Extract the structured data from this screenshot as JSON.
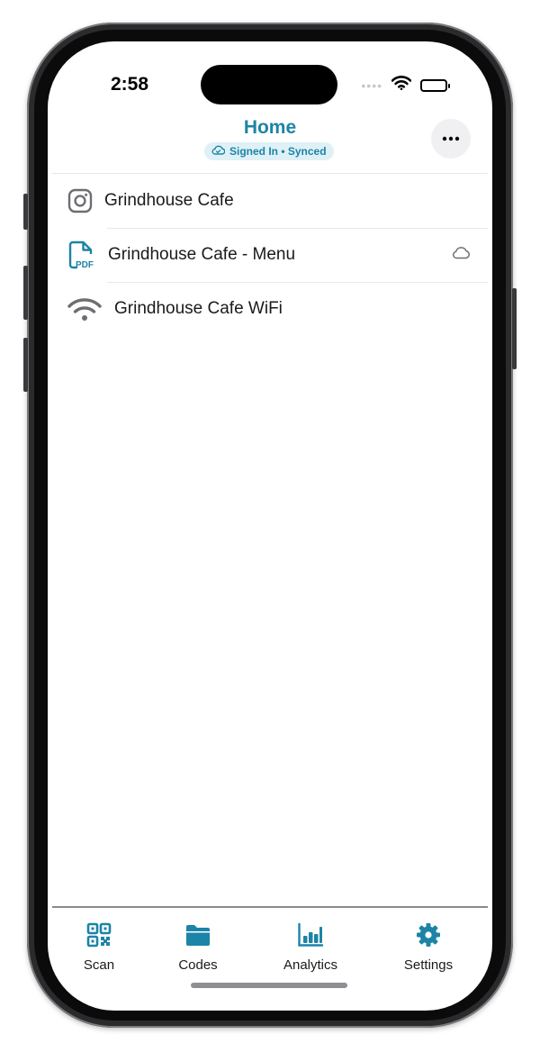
{
  "status_bar": {
    "time": "2:58",
    "signal_dots": "••••"
  },
  "header": {
    "title": "Home",
    "sync_status": "Signed In • Synced",
    "more_label": "•••"
  },
  "items": [
    {
      "label": "Grindhouse Cafe",
      "icon": "instagram-icon"
    },
    {
      "label": "Grindhouse Cafe - Menu",
      "icon": "pdf-icon",
      "pdf_text": "PDF",
      "trailing_icon": "cloud-icon"
    },
    {
      "label": "Grindhouse Cafe WiFi",
      "icon": "wifi-icon"
    }
  ],
  "tabs": [
    {
      "label": "Scan",
      "icon": "qr-code-icon"
    },
    {
      "label": "Codes",
      "icon": "folder-icon"
    },
    {
      "label": "Analytics",
      "icon": "bar-chart-icon"
    },
    {
      "label": "Settings",
      "icon": "gear-icon"
    }
  ],
  "colors": {
    "accent": "#1c84a6",
    "badge_bg": "#dff1f7",
    "icon_gray": "#6d6d72"
  }
}
